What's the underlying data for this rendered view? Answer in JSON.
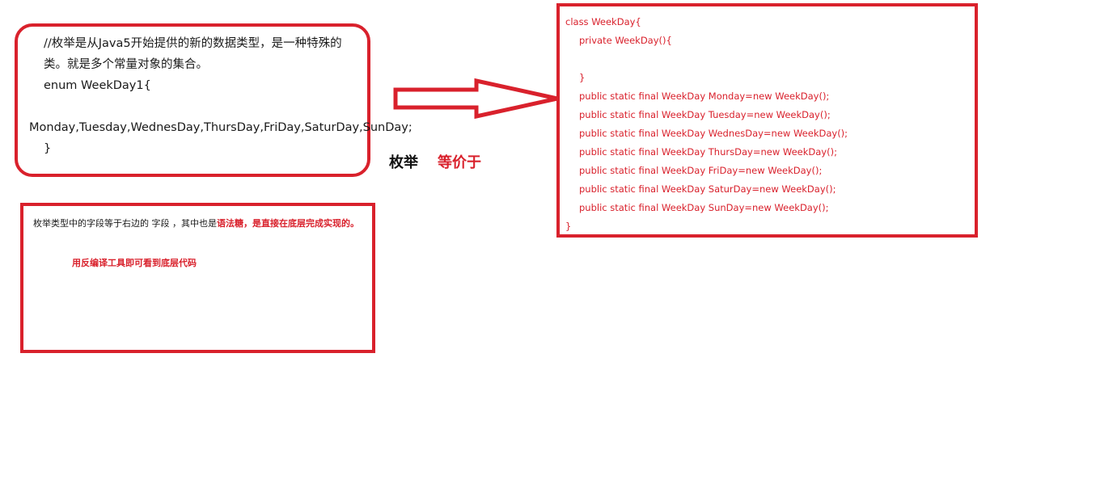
{
  "enum_box": {
    "comment": "//枚举是从Java5开始提供的新的数据类型，是一种特殊的类。就是多个常量对象的集合。",
    "decl": "enum WeekDay1{",
    "constants": "Monday,Tuesday,WednesDay,ThursDay,FriDay,SaturDay,SunDay;",
    "close": "}"
  },
  "note_box": {
    "text_plain": "枚举类型中的字段等于右边的 字段 ，其中也是",
    "text_red": "语法糖，是直接在底层完成实现的。",
    "tip": "用反编译工具即可看到底层代码"
  },
  "labels": {
    "enum": "枚举",
    "equivalent": "等价于"
  },
  "class_box": {
    "lines": [
      "class WeekDay{",
      "private WeekDay(){",
      "",
      "}",
      "public static final WeekDay Monday=new WeekDay();",
      "public static final WeekDay Tuesday=new WeekDay();",
      "public static final WeekDay WednesDay=new WeekDay();",
      "public static final WeekDay ThursDay=new WeekDay();",
      "public static final WeekDay FriDay=new WeekDay();",
      "public static final WeekDay SaturDay=new WeekDay();",
      "public static final WeekDay SunDay=new WeekDay();",
      "}"
    ]
  },
  "colors": {
    "accent_red": "#d9212c",
    "text_dark": "#1a1a1a"
  }
}
